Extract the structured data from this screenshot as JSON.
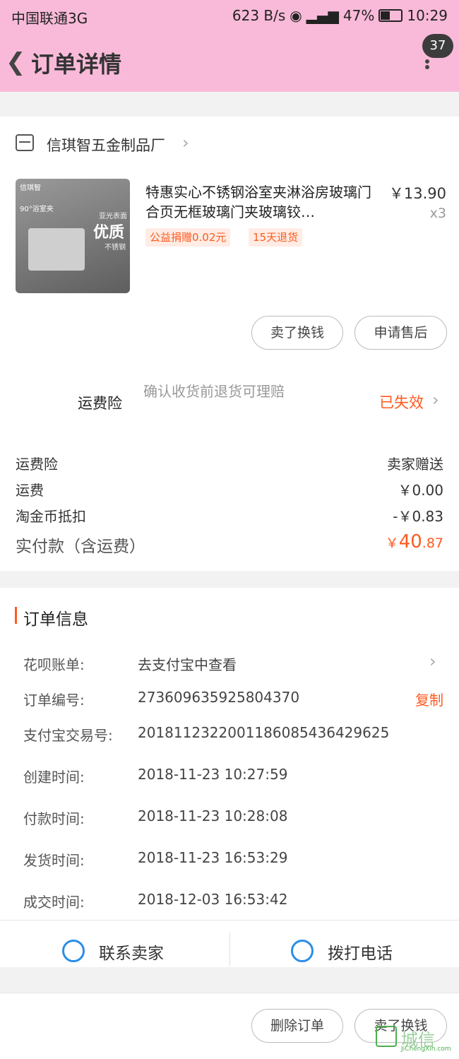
{
  "status_bar": {
    "carrier": "中国联通3G",
    "speed": "623 B/s",
    "battery": "47%",
    "time": "10:29"
  },
  "header": {
    "title": "订单详情",
    "badge_count": "37"
  },
  "shop": {
    "name": "信琪智五金制品厂"
  },
  "product": {
    "title": "特惠实心不锈钢浴室夹淋浴房玻璃门合页无框玻璃门夹玻璃铰…",
    "price": "￥13.90",
    "quantity": "x3",
    "tags": [
      "公益捐赠0.02元",
      "15天退货"
    ],
    "image_text": {
      "brand": "信琪智",
      "angle": "90°浴室夹",
      "line1": "亚光表面",
      "line2": "优质",
      "line3": "不锈钢"
    }
  },
  "product_actions": {
    "sell": "卖了换钱",
    "after_sale": "申请售后"
  },
  "insurance": {
    "label": "运费险",
    "desc": "确认收货前退货可理赔",
    "status": "已失效"
  },
  "costs": [
    {
      "label": "运费险",
      "value": "卖家赠送"
    },
    {
      "label": "运费",
      "value": "￥0.00"
    },
    {
      "label": "淘金币抵扣",
      "value": "-￥0.83"
    }
  ],
  "payment": {
    "label": "实付款（含运费）",
    "currency": "￥",
    "integer": "40",
    "decimal": ".87"
  },
  "order_info": {
    "title": "订单信息",
    "rows": [
      {
        "label": "花呗账单:",
        "value": "去支付宝中查看"
      },
      {
        "label": "订单编号:",
        "value": "273609635925804370"
      },
      {
        "label": "支付宝交易号:",
        "value": "2018112322001186085436429625"
      },
      {
        "label": "创建时间:",
        "value": "2018-11-23 10:27:59"
      },
      {
        "label": "付款时间:",
        "value": "2018-11-23 10:28:08"
      },
      {
        "label": "发货时间:",
        "value": "2018-11-23 16:53:29"
      },
      {
        "label": "成交时间:",
        "value": "2018-12-03 16:53:42"
      }
    ],
    "copy_label": "复制"
  },
  "contact": {
    "seller": "联系卖家",
    "phone": "拨打电话"
  },
  "bottom_actions": {
    "delete": "删除订单",
    "sell": "卖了换钱"
  },
  "watermark": {
    "text": "城信",
    "sub": "JiChengXin.com"
  },
  "colors": {
    "accent": "#ff5a1f",
    "header_bg": "#f9bad9",
    "link_blue": "#2a8de8"
  }
}
